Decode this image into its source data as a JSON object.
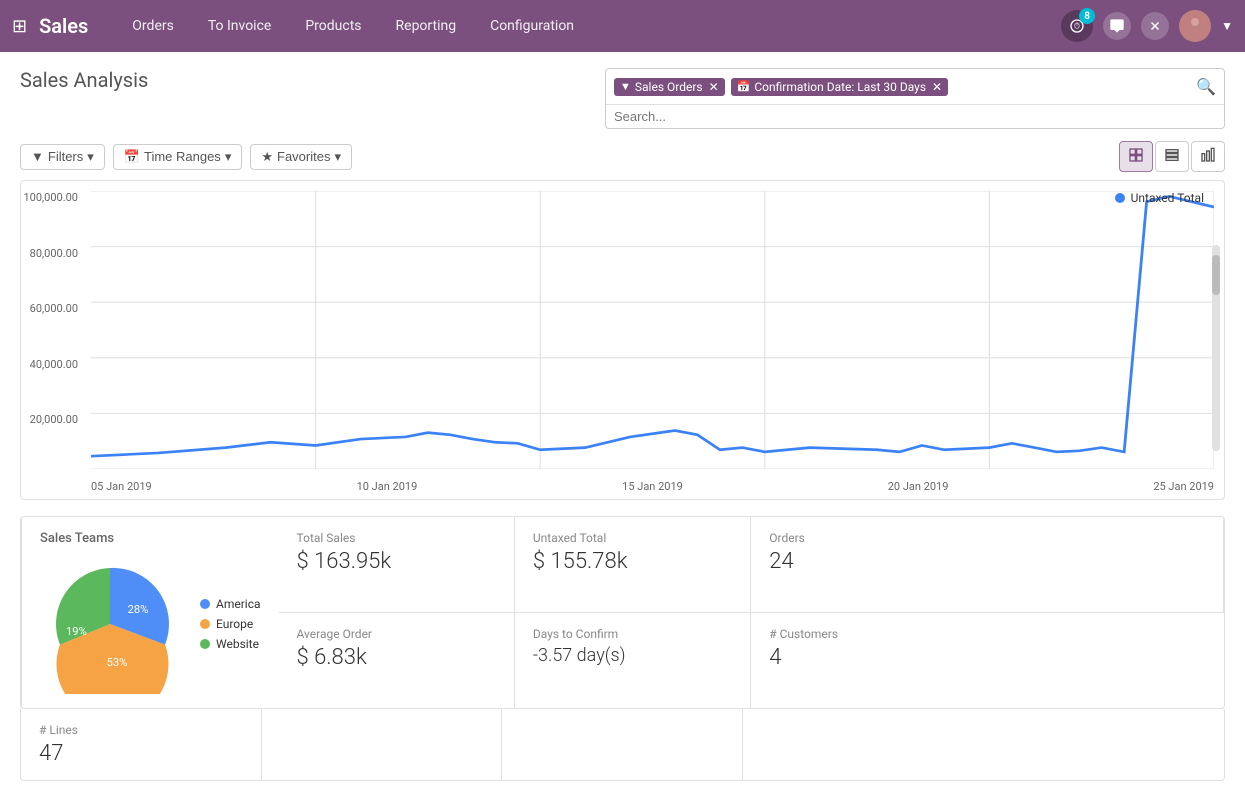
{
  "app": {
    "name": "Sales",
    "grid_icon": "⊞"
  },
  "nav": {
    "items": [
      {
        "label": "Orders"
      },
      {
        "label": "To Invoice"
      },
      {
        "label": "Products"
      },
      {
        "label": "Reporting"
      },
      {
        "label": "Configuration"
      }
    ]
  },
  "topnav_right": {
    "notification_count": "8",
    "chat_icon": "💬",
    "close_icon": "✕"
  },
  "page": {
    "title": "Sales Analysis"
  },
  "search": {
    "placeholder": "Search...",
    "filters": [
      {
        "icon": "▼",
        "label": "Sales Orders",
        "closable": true
      },
      {
        "icon": "📅",
        "label": "Confirmation Date: Last 30 Days",
        "closable": true
      }
    ]
  },
  "toolbar": {
    "filters_label": "Filters",
    "time_ranges_label": "Time Ranges",
    "favorites_label": "Favorites",
    "views": [
      "pivot",
      "grid",
      "bar"
    ]
  },
  "chart": {
    "legend": "Untaxed Total",
    "y_labels": [
      "100,000.00",
      "80,000.00",
      "60,000.00",
      "40,000.00",
      "20,000.00",
      ""
    ],
    "x_labels": [
      "05 Jan 2019",
      "10 Jan 2019",
      "15 Jan 2019",
      "20 Jan 2019",
      "25 Jan 2019"
    ],
    "color": "#3b82f6"
  },
  "stats": [
    {
      "label": "Total Sales",
      "value": "$ 163.95k"
    },
    {
      "label": "Untaxed Total",
      "value": "$ 155.78k"
    },
    {
      "label": "Orders",
      "value": "24"
    },
    {
      "label": "Average Order",
      "value": "$ 6.83k"
    },
    {
      "label": "Days to Confirm",
      "value": "-3.57 day(s)"
    },
    {
      "label": "# Customers",
      "value": "4"
    }
  ],
  "lines_stat": {
    "label": "# Lines",
    "value": "47"
  },
  "sales_teams": {
    "title": "Sales Teams",
    "segments": [
      {
        "label": "America",
        "color": "#4f8ef7",
        "percent": 28
      },
      {
        "label": "Europe",
        "color": "#f5a344",
        "percent": 53
      },
      {
        "label": "Website",
        "color": "#5cb85c",
        "percent": 19
      }
    ]
  }
}
